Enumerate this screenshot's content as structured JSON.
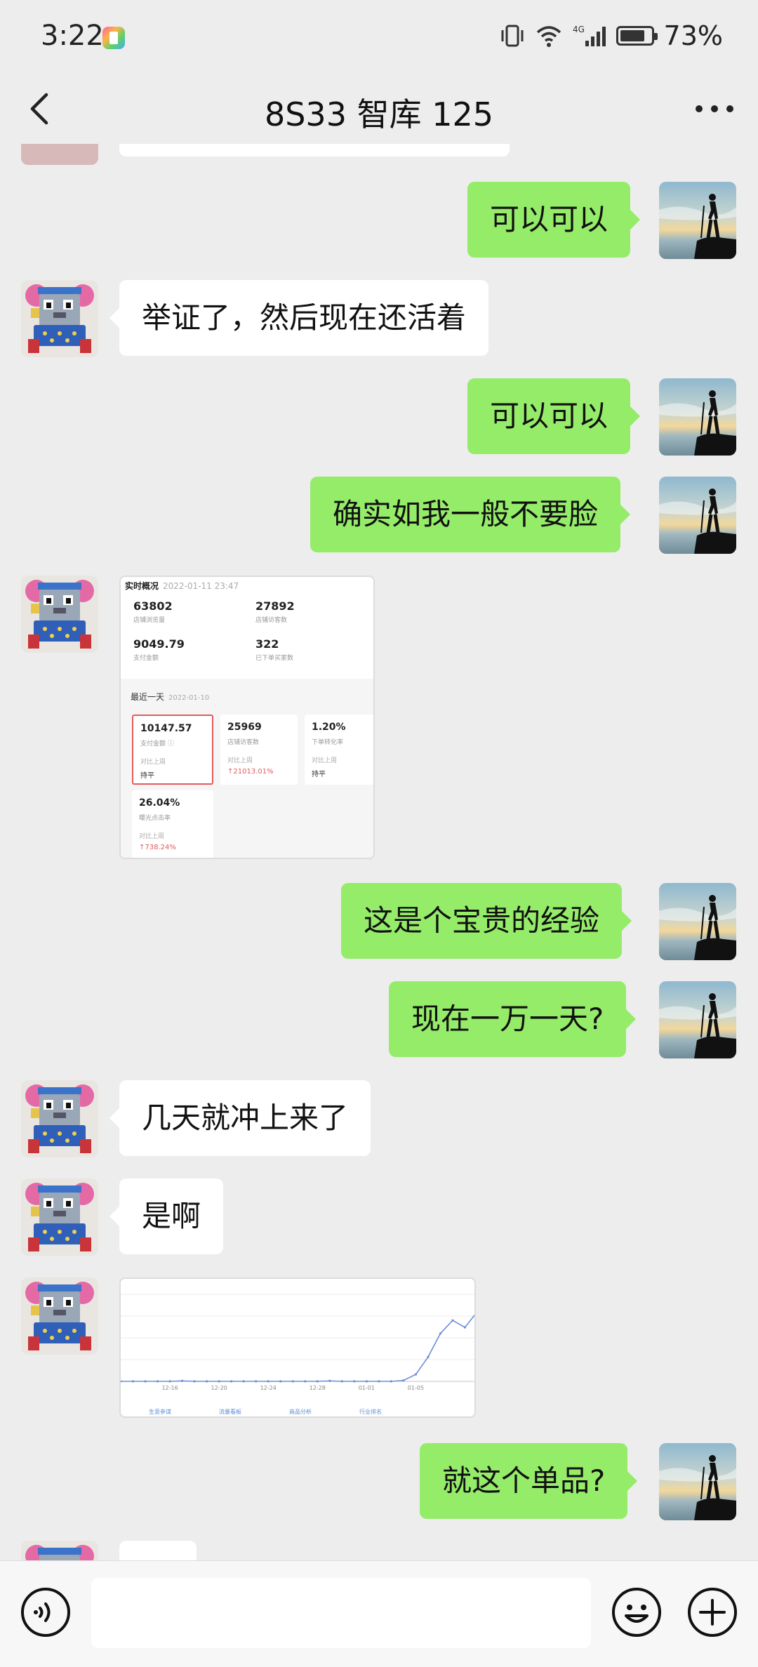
{
  "status_bar": {
    "time": "3:22",
    "network": "4G",
    "battery": "73%"
  },
  "header": {
    "title": "8S33 智库 125"
  },
  "messages": [
    {
      "side": "out",
      "text": "可以可以"
    },
    {
      "side": "in",
      "text": "举证了，然后现在还活着"
    },
    {
      "side": "out",
      "text": "可以可以"
    },
    {
      "side": "out",
      "text": "确实如我一般不要脸"
    },
    {
      "side": "in",
      "type": "image",
      "image": "realtime-overview-screenshot"
    },
    {
      "side": "out",
      "text": "这是个宝贵的经验"
    },
    {
      "side": "out",
      "text": "现在一万一天?"
    },
    {
      "side": "in",
      "text": "几天就冲上来了"
    },
    {
      "side": "in",
      "text": "是啊"
    },
    {
      "side": "in",
      "type": "image",
      "image": "trend-chart-screenshot"
    },
    {
      "side": "out",
      "text": "就这个单品?"
    }
  ],
  "realtime_card": {
    "heading": "实时概况",
    "timestamp": "2022-01-11 23:47",
    "stats": [
      {
        "value": "63802",
        "label": "店铺浏览量"
      },
      {
        "value": "27892",
        "label": "店铺访客数"
      },
      {
        "value": "9049.79",
        "label": "支付金额"
      },
      {
        "value": "322",
        "label": "已下单买家数"
      }
    ],
    "recent_label": "最近一天",
    "recent_date": "2022-01-10",
    "compare_label": "对比上周",
    "metrics": [
      {
        "value": "10147.57",
        "label": "支付金额 ⓘ",
        "delta": "持平",
        "delta_red": false
      },
      {
        "value": "25969",
        "label": "店铺访客数",
        "delta": "↑21013.01%",
        "delta_red": true
      },
      {
        "value": "1.20%",
        "label": "下单转化率",
        "delta": "持平",
        "delta_red": false
      },
      {
        "value": "26.04%",
        "label": "曝光点击率",
        "delta": "↑738.24%",
        "delta_red": true
      }
    ]
  },
  "chart_data": {
    "type": "line",
    "title": "",
    "xlabel": "",
    "ylabel": "",
    "x": [
      "12-12",
      "12-13",
      "12-14",
      "12-15",
      "12-16",
      "12-17",
      "12-18",
      "12-19",
      "12-20",
      "12-21",
      "12-22",
      "12-23",
      "12-24",
      "12-25",
      "12-26",
      "12-27",
      "12-28",
      "12-29",
      "12-30",
      "12-31",
      "01-01",
      "01-02",
      "01-03",
      "01-04",
      "01-05",
      "01-06",
      "01-07",
      "01-08",
      "01-09",
      "01-10"
    ],
    "x_tick_labels": [
      "12-16",
      "12-20",
      "12-24",
      "12-28",
      "01-01",
      "01-05"
    ],
    "series": [
      {
        "values": [
          0,
          0,
          0,
          0,
          0,
          0.5,
          0,
          0,
          0,
          0,
          0,
          0,
          0,
          0,
          0,
          0,
          0,
          0.5,
          0,
          0,
          0,
          0,
          0,
          1,
          8,
          28,
          55,
          70,
          62,
          80
        ]
      }
    ],
    "ylim": [
      0,
      100
    ],
    "grid": true,
    "footer_tabs": [
      "生意参谋",
      "流量看板",
      "商品分析",
      "行业排名"
    ]
  },
  "input_bar": {
    "placeholder": ""
  },
  "colors": {
    "outgoing_bubble": "#95ec69",
    "incoming_bubble": "#ffffff",
    "background": "#ededed",
    "chart_line": "#6b8fd6"
  }
}
